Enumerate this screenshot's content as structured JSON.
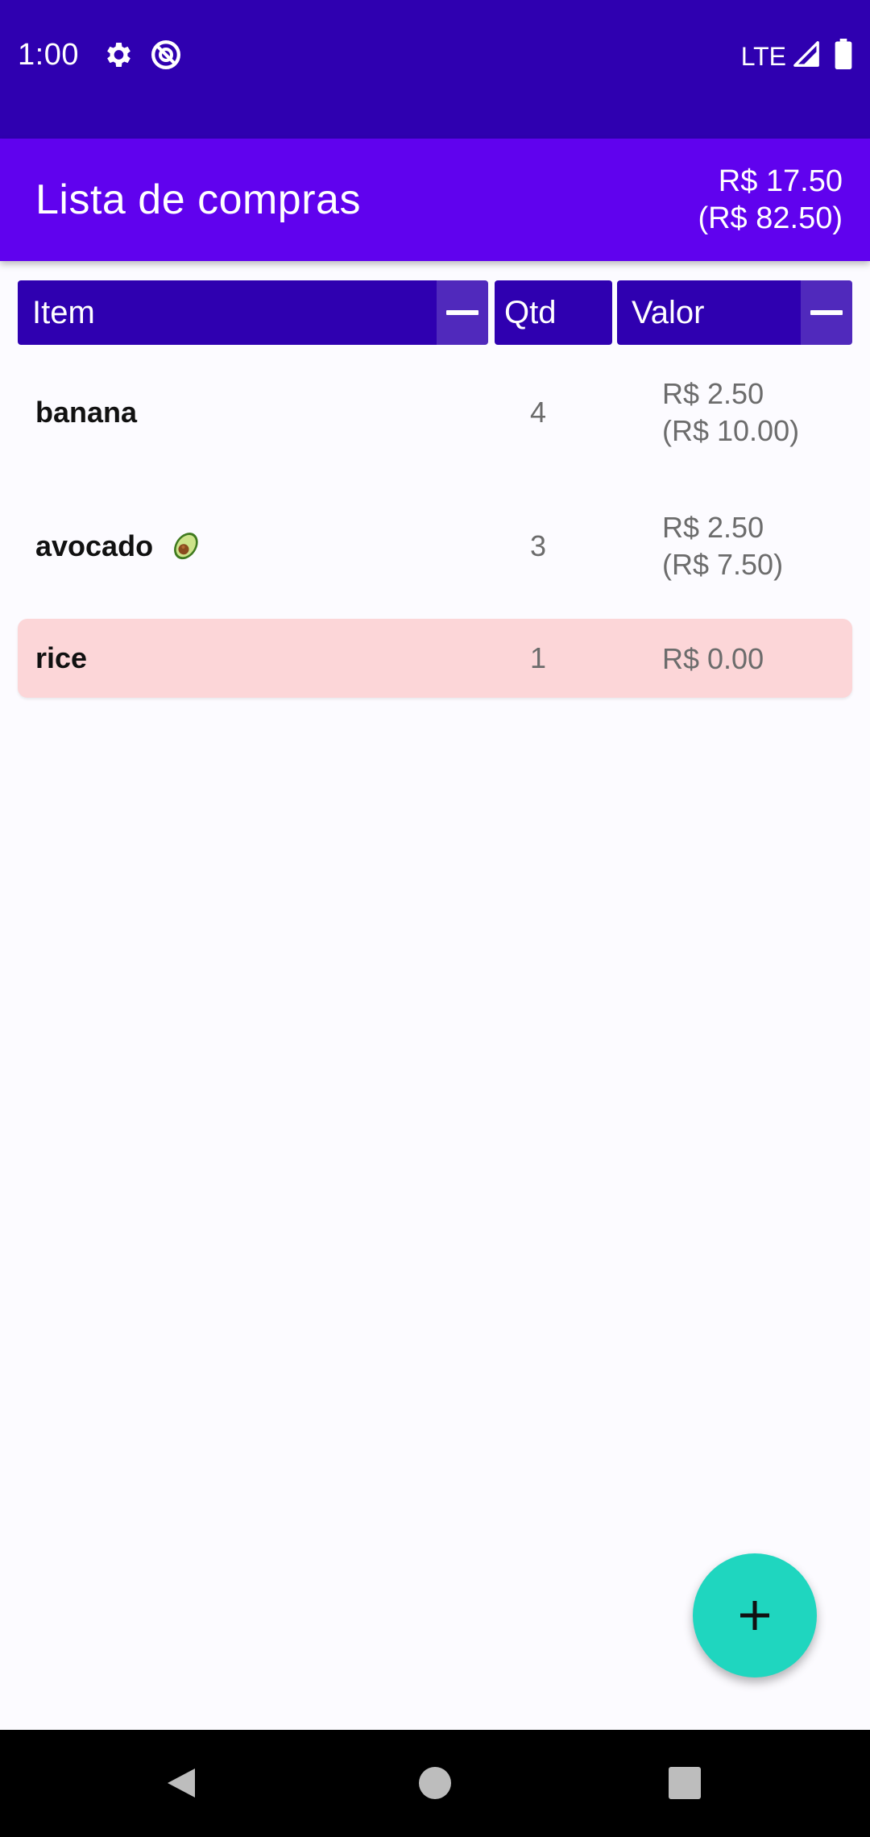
{
  "status_bar": {
    "time": "1:00",
    "network": "LTE",
    "icons": [
      "gear-icon",
      "dnd-icon",
      "signal-icon",
      "battery-icon"
    ]
  },
  "app_bar": {
    "title": "Lista de compras",
    "total_checked": "R$ 17.50",
    "total_all": "(R$ 82.50)"
  },
  "columns": {
    "item": "Item",
    "qtd": "Qtd",
    "valor": "Valor"
  },
  "items": [
    {
      "name": "banana",
      "qty": "4",
      "unit_price": "R$ 2.50",
      "total": "(R$ 10.00)"
    },
    {
      "name": "avocado",
      "emoji": "avocado-icon",
      "qty": "3",
      "unit_price": "R$ 2.50",
      "total": "(R$ 7.50)"
    },
    {
      "name": "rice",
      "qty": "1",
      "unit_price": "R$ 0.00",
      "highlight_color": "#fcd6d8"
    }
  ],
  "fab": {
    "icon": "plus-icon"
  },
  "nav_bar": {
    "icons": [
      "back-icon",
      "home-icon",
      "recents-icon"
    ]
  },
  "colors": {
    "status_bar": "#2f00b0",
    "app_bar": "#6002ee",
    "header": "#2f00b0",
    "fab": "#1fd6bf",
    "highlight_row": "#fcd6d8"
  }
}
